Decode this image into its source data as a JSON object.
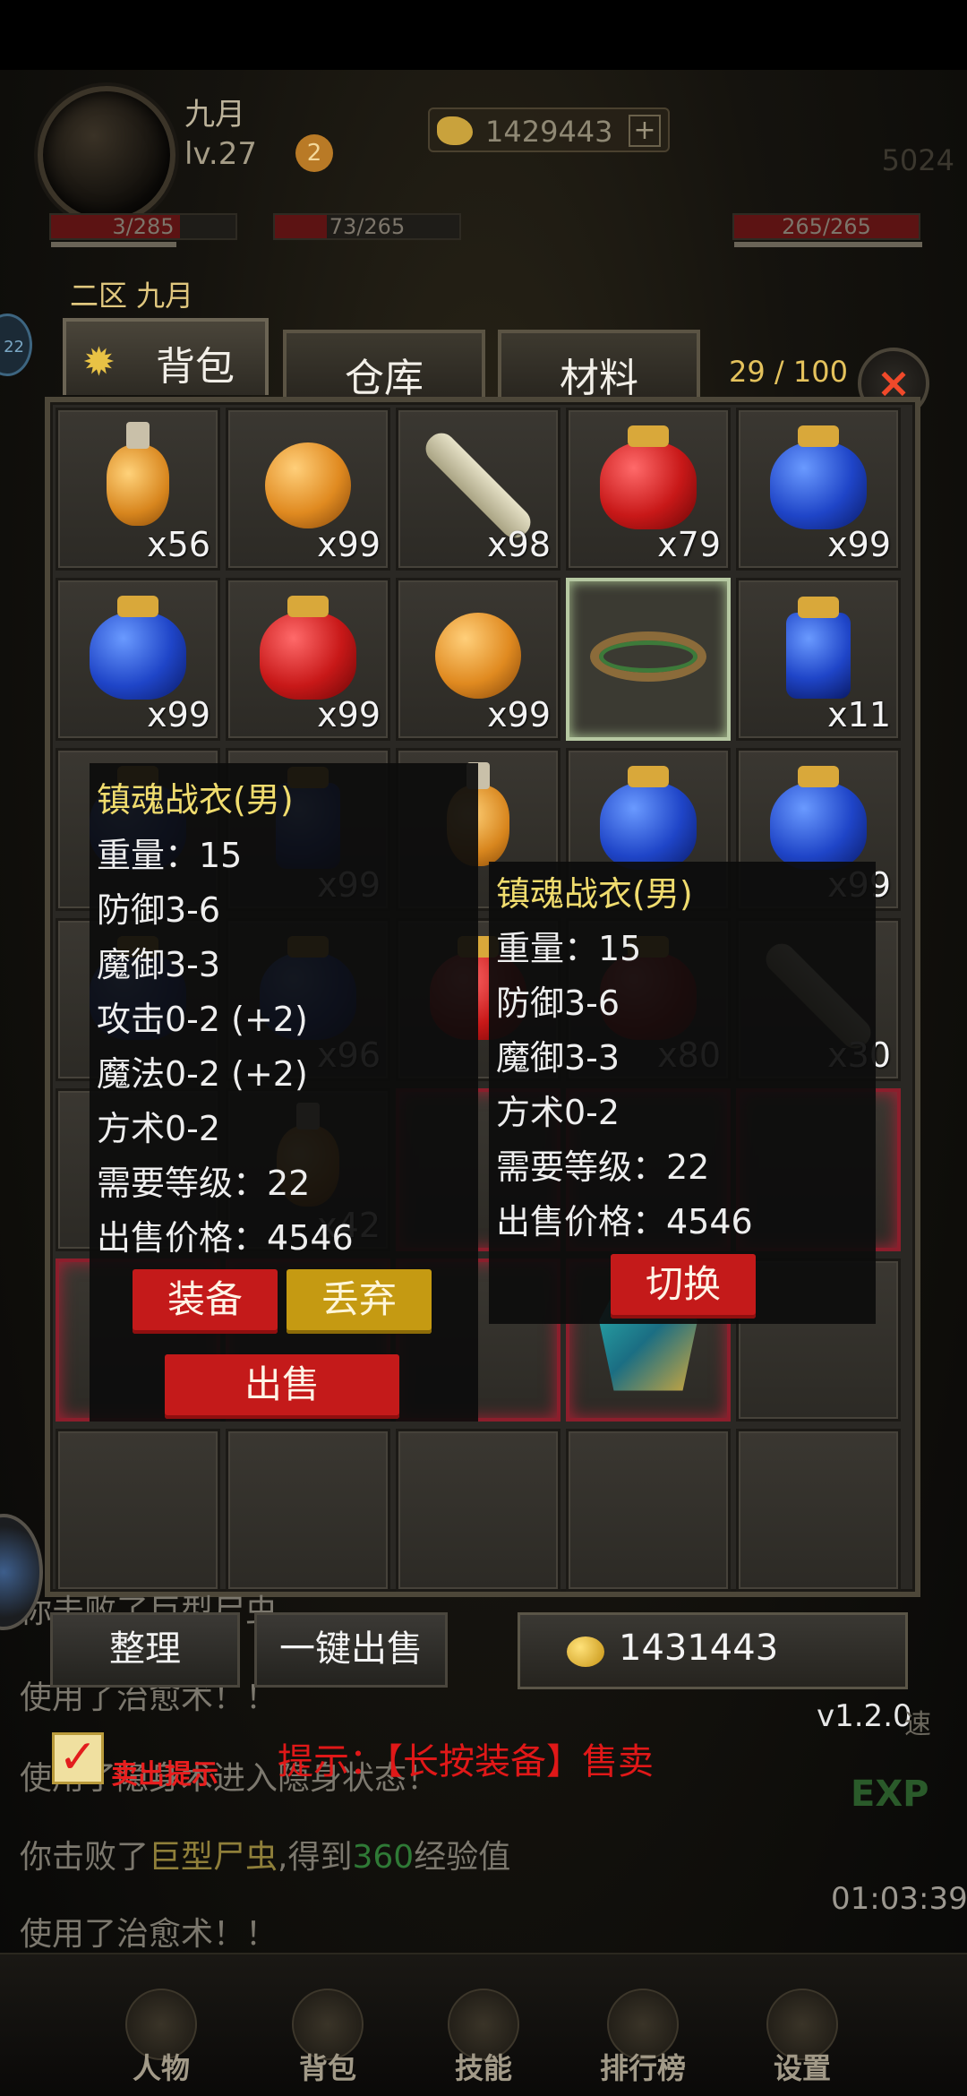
{
  "player": {
    "name": "九月",
    "level": "lv.27",
    "badge": "2",
    "gold_top": "1429443",
    "power": "5024"
  },
  "bars": [
    {
      "text": "3/285",
      "fill": 0.7
    },
    {
      "text": "73/265",
      "fill": 0.28
    },
    {
      "text": "265/265",
      "fill": 1.0
    }
  ],
  "region": "二区 九月",
  "side_left_text": "22",
  "tabs": [
    {
      "label": "背包",
      "active": true
    },
    {
      "label": "仓库",
      "active": false
    },
    {
      "label": "材料",
      "active": false
    }
  ],
  "capacity": "29 / 100",
  "close_glyph": "×",
  "grid": [
    [
      {
        "type": "flask",
        "qty": "x56"
      },
      {
        "type": "roundpot",
        "qty": "x99"
      },
      {
        "type": "scroll",
        "qty": "x98"
      },
      {
        "type": "jar-red",
        "qty": "x79"
      },
      {
        "type": "jar-blue",
        "qty": "x99"
      }
    ],
    [
      {
        "type": "jar-blue",
        "qty": "x99"
      },
      {
        "type": "jar-red",
        "qty": "x99"
      },
      {
        "type": "roundpot",
        "qty": "x99"
      },
      {
        "type": "ring",
        "qty": "",
        "highlight": true
      },
      {
        "type": "bottle-blue",
        "qty": "x11"
      }
    ],
    [
      {
        "type": "jar-blue",
        "qty": ""
      },
      {
        "type": "bottle-blue",
        "qty": "x99"
      },
      {
        "type": "flask",
        "qty": ""
      },
      {
        "type": "jar-blue",
        "qty": ""
      },
      {
        "type": "jar-blue",
        "qty": "x99"
      }
    ],
    [
      {
        "type": "jar-blue",
        "qty": ""
      },
      {
        "type": "jar-blue",
        "qty": "x96"
      },
      {
        "type": "jar-red",
        "qty": ""
      },
      {
        "type": "jar-red",
        "qty": "x80"
      },
      {
        "type": "scroll",
        "qty": "x30"
      }
    ],
    [
      {
        "type": "empty",
        "qty": ""
      },
      {
        "type": "flask",
        "qty": "x42"
      },
      {
        "type": "empty",
        "qty": "",
        "red": true
      },
      {
        "type": "empty",
        "qty": "",
        "red": true
      },
      {
        "type": "empty",
        "qty": "",
        "red": true
      }
    ],
    [
      {
        "type": "empty",
        "qty": "",
        "red": true
      },
      {
        "type": "empty",
        "qty": "",
        "red": true
      },
      {
        "type": "empty",
        "qty": "",
        "red": true
      },
      {
        "type": "robe",
        "qty": "",
        "red": true
      },
      {
        "type": "empty",
        "qty": ""
      }
    ],
    [
      {
        "type": "empty",
        "qty": ""
      },
      {
        "type": "empty",
        "qty": ""
      },
      {
        "type": "empty",
        "qty": ""
      },
      {
        "type": "empty",
        "qty": ""
      },
      {
        "type": "empty",
        "qty": ""
      }
    ]
  ],
  "tooltip_left": {
    "name": "镇魂战衣(男)",
    "lines": [
      "重量：15",
      "防御3-6",
      "魔御3-3",
      "攻击0-2 (+2)",
      "魔法0-2 (+2)",
      "方术0-2",
      "需要等级：22",
      "出售价格：4546"
    ],
    "btn_equip": "装备",
    "btn_drop": "丢弃",
    "btn_sell": "出售"
  },
  "tooltip_right": {
    "name": "镇魂战衣(男)",
    "lines": [
      "重量：15",
      "防御3-6",
      "魔御3-3",
      "方术0-2",
      "需要等级：22",
      "出售价格：4546"
    ],
    "btn_switch": "切换"
  },
  "actions": {
    "sort": "整理",
    "sell_all": "一键出售"
  },
  "gold": "1431443",
  "version": "v1.2.0",
  "speed": "速",
  "checkbox": {
    "checked": "✓",
    "label": "卖出提示"
  },
  "hint": "提示：【长按装备】售卖",
  "log": {
    "line1": "使用了治愈术！！",
    "line2": "使用了隐身术进入隐身状态！",
    "line3_a": "你击败了",
    "line3_b": "巨型尸虫",
    "line3_c": ",得到",
    "line3_d": "360",
    "line3_e": "经验值",
    "line4": "使用了治愈术！！",
    "line0": "你击败了巨型尸虫",
    "clock": "01:03:39"
  },
  "exp_label": "EXP",
  "nav": [
    "人物",
    "背包",
    "技能",
    "排行榜",
    "设置"
  ],
  "colors": {
    "accent_gold": "#e4c25c",
    "danger_red": "#c41a1a",
    "item_name": "#f0dc6e"
  }
}
